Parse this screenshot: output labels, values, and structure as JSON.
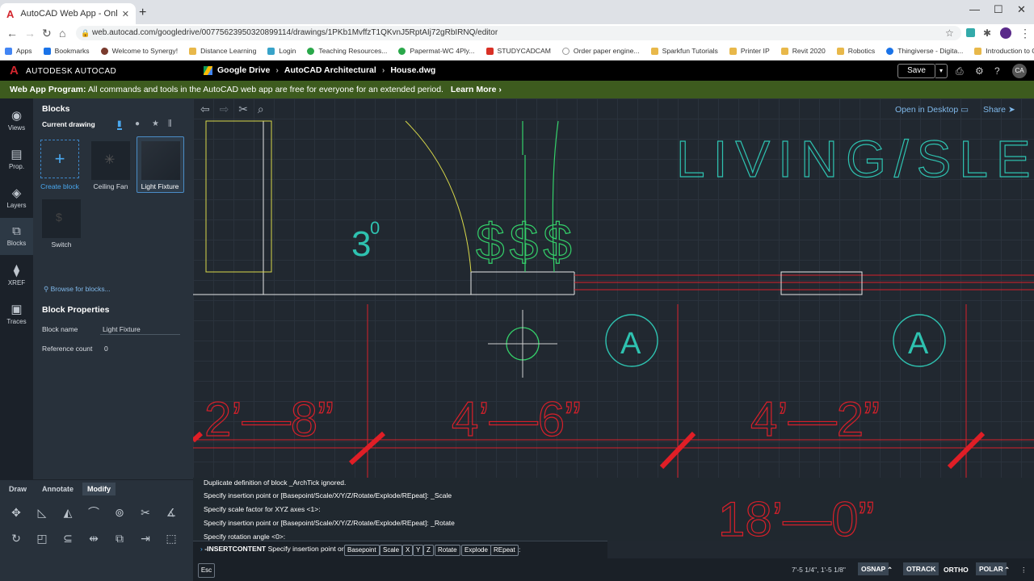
{
  "browser": {
    "tab_title": "AutoCAD Web App - Online CAD",
    "new_tab": "+",
    "url": "web.autocad.com/googledrive/00775623950320899114/drawings/1PKb1MvffzT1QKvnJ5RptAIj72gRbIRNQ/editor",
    "bookmarks": [
      "Apps",
      "Bookmarks",
      "Welcome to Synergy!",
      "Distance Learning",
      "Login",
      "Teaching Resources...",
      "Papermat-WC 4Ply...",
      "STUDYCADCAM",
      "Order paper engine...",
      "Sparkfun Tutorials",
      "Printer IP",
      "Revit 2020",
      "Robotics",
      "Thingiverse - Digita...",
      "Introduction to CA..."
    ]
  },
  "header": {
    "brand": "AUTODESK  AUTOCAD",
    "breadcrumb": [
      "Google Drive",
      "AutoCAD Architectural",
      "House.dwg"
    ],
    "save_label": "Save",
    "avatar": "CA"
  },
  "banner": {
    "bold": "Web App Program:",
    "text": " All commands and tools in the AutoCAD web app are free for everyone for an extended period.",
    "link": "Learn More ›"
  },
  "rail": [
    {
      "label": "Views",
      "icon": "eye-icon"
    },
    {
      "label": "Prop.",
      "icon": "properties-icon"
    },
    {
      "label": "Layers",
      "icon": "layers-icon"
    },
    {
      "label": "Blocks",
      "icon": "blocks-icon"
    },
    {
      "label": "XREF",
      "icon": "xref-icon"
    },
    {
      "label": "Traces",
      "icon": "traces-icon"
    }
  ],
  "blocks_panel": {
    "title": "Blocks",
    "current_drawing": "Current drawing",
    "tiles": [
      "Create block",
      "Ceiling Fan",
      "Light Fixture",
      "Switch"
    ],
    "browse": "Browse for blocks...",
    "properties_title": "Block Properties",
    "block_name_label": "Block name",
    "block_name_value": "Light Fixture",
    "ref_count_label": "Reference count",
    "ref_count_value": "0"
  },
  "tool_tabs": [
    "Draw",
    "Annotate",
    "Modify"
  ],
  "canvas": {
    "open_desktop": "Open in Desktop",
    "share": "Share",
    "room_label": "LIVING/SLEEPI",
    "angle_label": "3",
    "angle_sup": "0",
    "switch_label": "$$$",
    "grid_bubble": "A",
    "dims": [
      "2’—8”",
      "4’—6”",
      "4’—2”",
      "18’—0”"
    ]
  },
  "command": {
    "history": [
      "Duplicate definition of block _ArchTick ignored.",
      "Specify insertion point or [Basepoint/Scale/X/Y/Z/Rotate/Explode/REpeat]: _Scale",
      "Specify scale factor for XYZ axes <1>:",
      "Specify insertion point or [Basepoint/Scale/X/Y/Z/Rotate/Explode/REpeat]: _Rotate",
      "Specify rotation angle <0>:"
    ],
    "prompt_bold": "-INSERTCONTENT",
    "prompt_text": " Specify insertion point or",
    "options": [
      "Basepoint",
      "Scale",
      "X",
      "Y",
      "Z",
      "Rotate",
      "Explode",
      "REpeat"
    ],
    "colon": ":"
  },
  "status": {
    "esc": "Esc",
    "coords": "7'-5 1/4\", 1'-5 1/8\"",
    "toggles": [
      "OSNAP",
      "OTRACK",
      "ORTHO",
      "POLAR"
    ]
  },
  "colors": {
    "cyan": "#2ec2b0",
    "green": "#34d06a",
    "yellow": "#d9d94a",
    "red": "#d8202a",
    "banner": "#3d5b1e"
  }
}
